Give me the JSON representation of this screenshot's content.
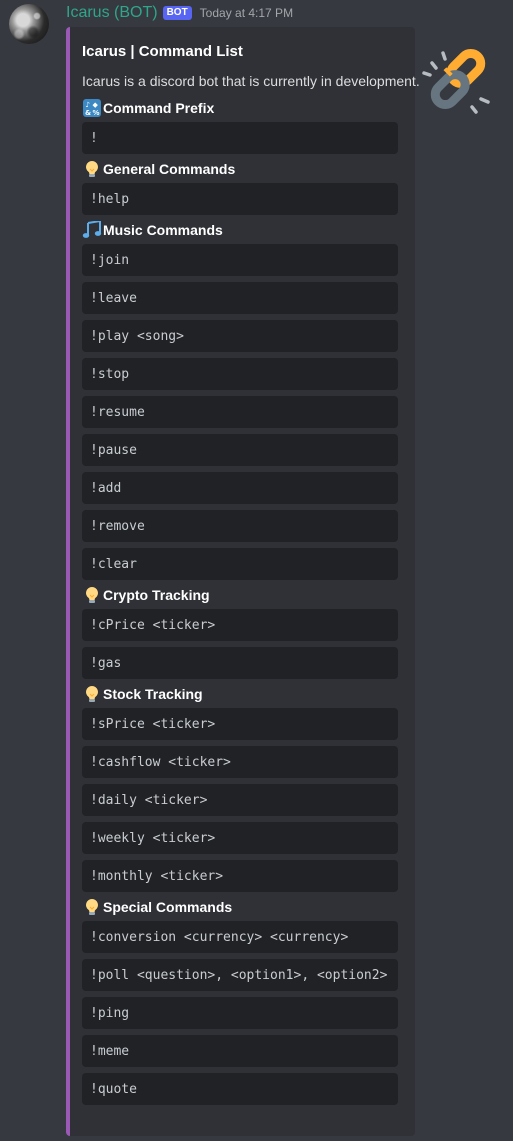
{
  "author": {
    "username": "Icarus (BOT)",
    "bot_tag": "BOT",
    "timestamp": "Today at 4:17 PM"
  },
  "embed": {
    "accent_color": "#9b59b6",
    "thumbnail_icon": "chain-link-icon",
    "title": "Icarus | Command List",
    "description": "Icarus is a discord bot that is currently in development.",
    "fields": [
      {
        "emoji": "symbols-input-icon",
        "name": "Command Prefix",
        "commands": [
          "!"
        ]
      },
      {
        "emoji": "light-bulb-icon",
        "name": "General Commands",
        "commands": [
          "!help"
        ]
      },
      {
        "emoji": "music-note-icon",
        "name": "Music Commands",
        "commands": [
          "!join",
          "!leave",
          "!play <song>",
          "!stop",
          "!resume",
          "!pause",
          "!add",
          "!remove",
          "!clear"
        ]
      },
      {
        "emoji": "light-bulb-icon",
        "name": "Crypto Tracking",
        "commands": [
          "!cPrice <ticker>",
          "!gas"
        ]
      },
      {
        "emoji": "light-bulb-icon",
        "name": "Stock Tracking",
        "commands": [
          "!sPrice <ticker>",
          "!cashflow <ticker>",
          "!daily <ticker>",
          "!weekly <ticker>",
          "!monthly <ticker>"
        ]
      },
      {
        "emoji": "light-bulb-icon",
        "name": "Special Commands",
        "commands": [
          "!conversion <currency> <currency>",
          "!poll <question>, <option1>, <option2>",
          "!ping",
          "!meme",
          "!quote"
        ]
      }
    ]
  }
}
